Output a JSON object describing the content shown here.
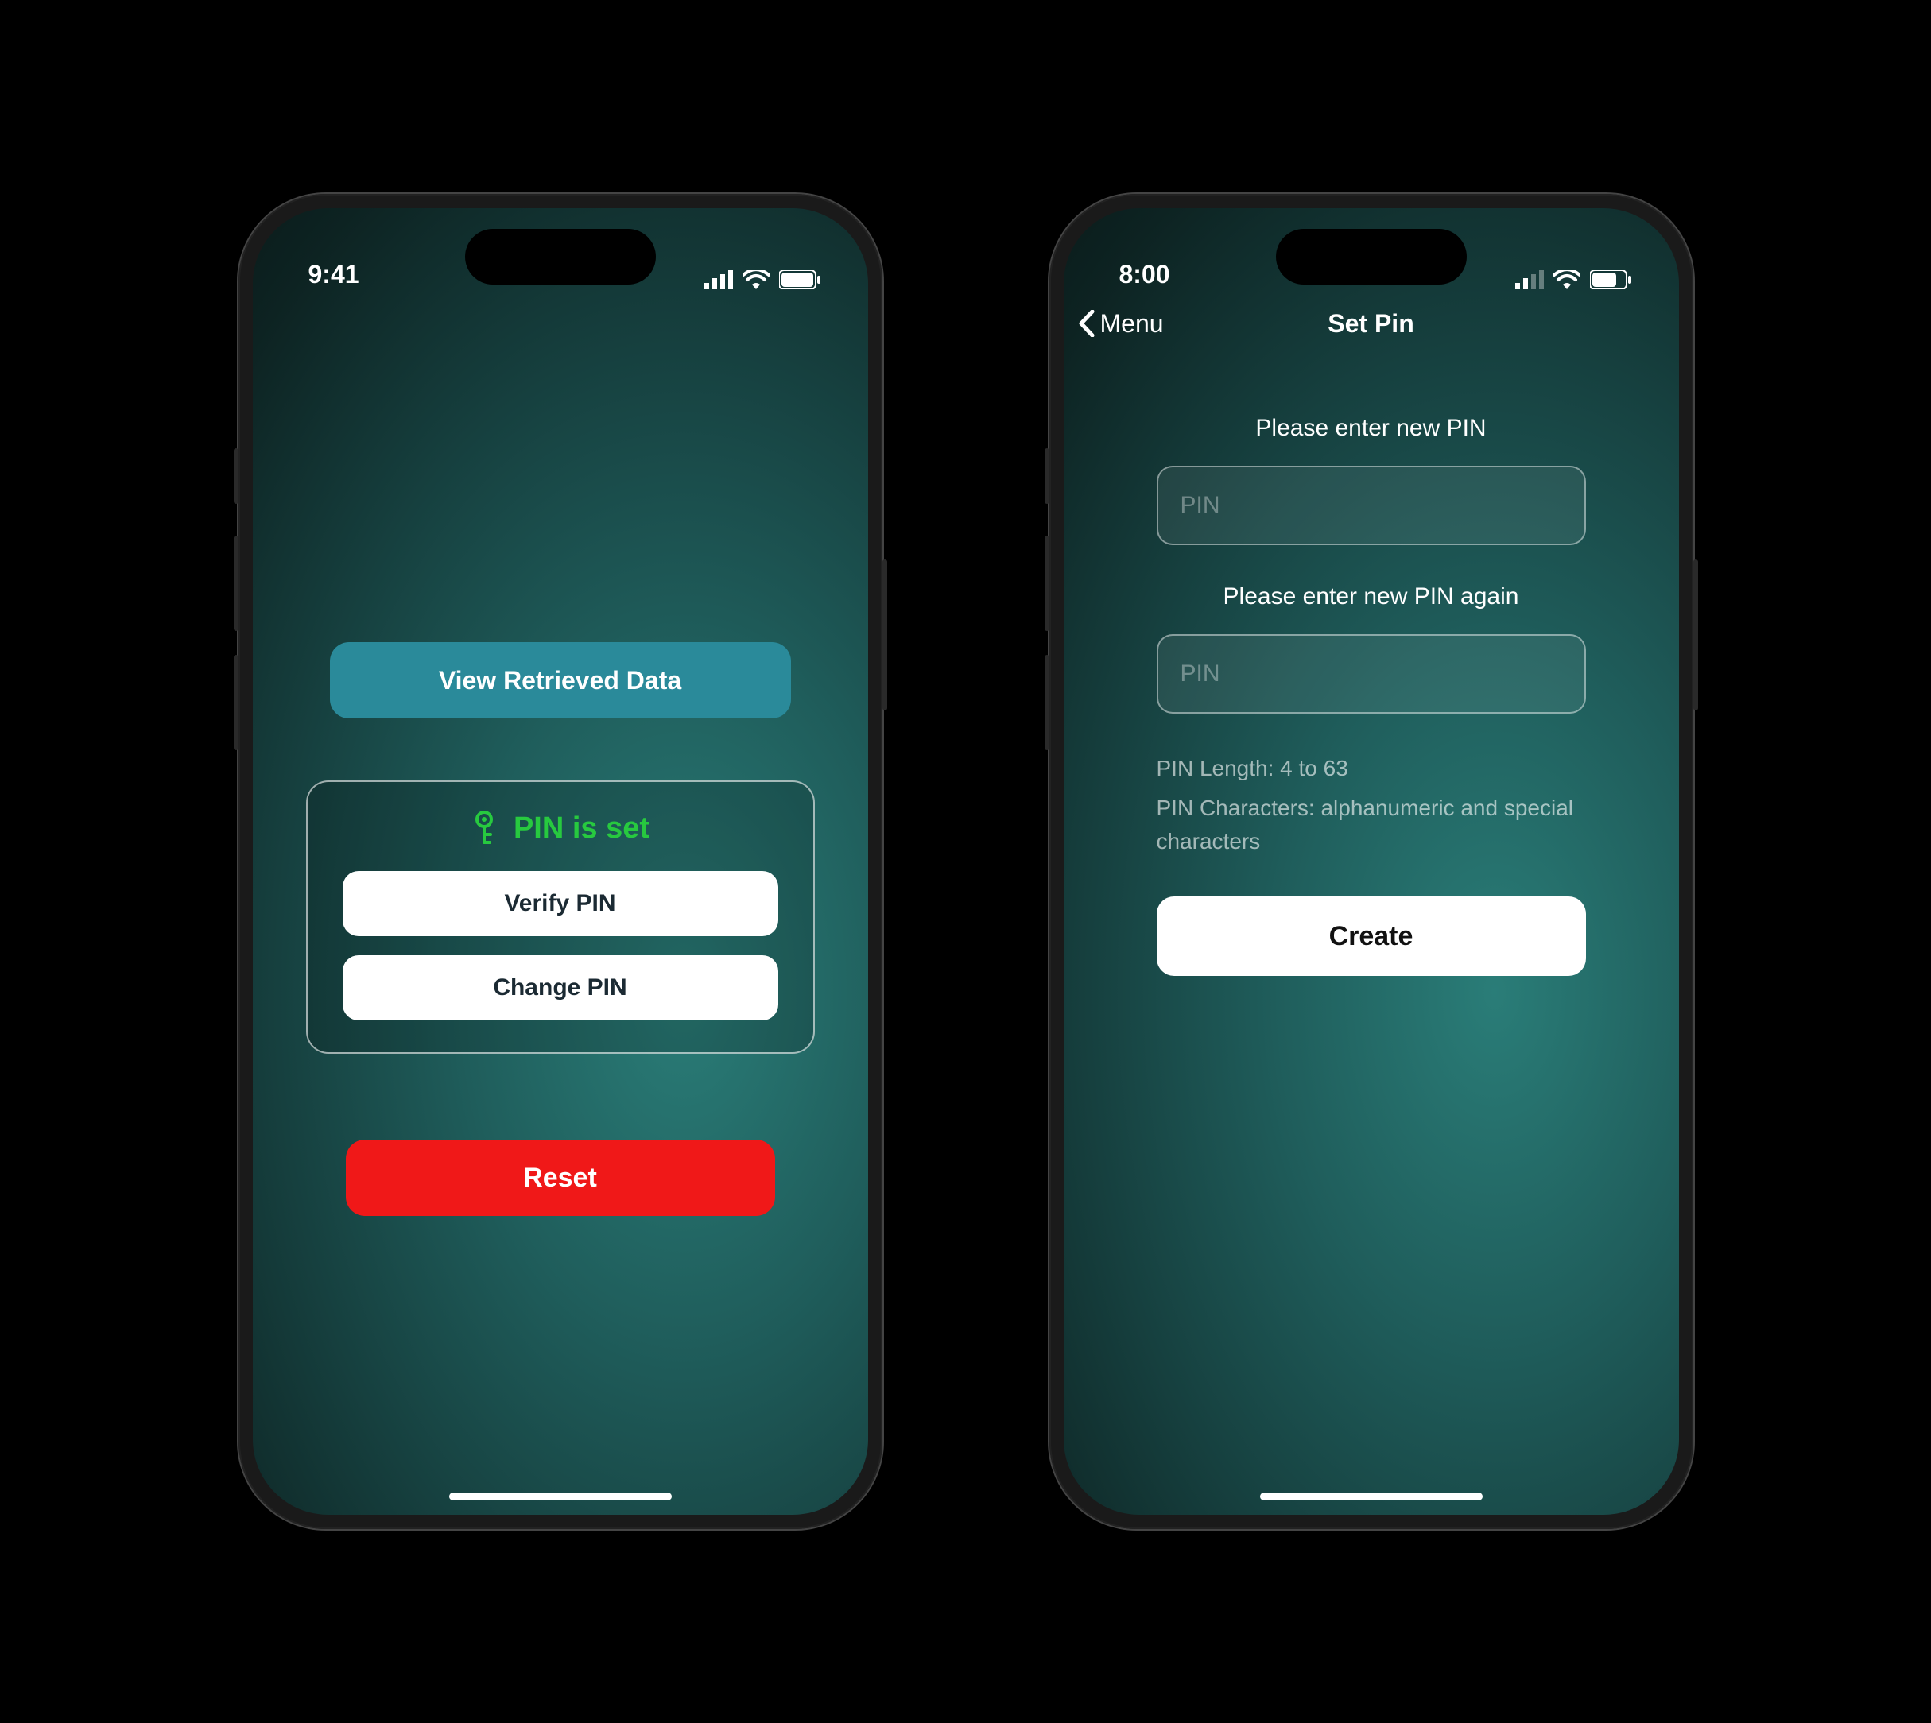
{
  "screen1": {
    "status_time": "9:41",
    "view_data_label": "View Retrieved Data",
    "pin_status_label": "PIN is set",
    "verify_pin_label": "Verify PIN",
    "change_pin_label": "Change PIN",
    "reset_label": "Reset"
  },
  "screen2": {
    "status_time": "8:00",
    "back_label": "Menu",
    "title": "Set Pin",
    "prompt1": "Please enter new PIN",
    "pin1_placeholder": "PIN",
    "prompt2": "Please enter new PIN again",
    "pin2_placeholder": "PIN",
    "hint_length": "PIN Length: 4 to 63",
    "hint_chars": "PIN Characters: alphanumeric and special characters",
    "create_label": "Create"
  }
}
